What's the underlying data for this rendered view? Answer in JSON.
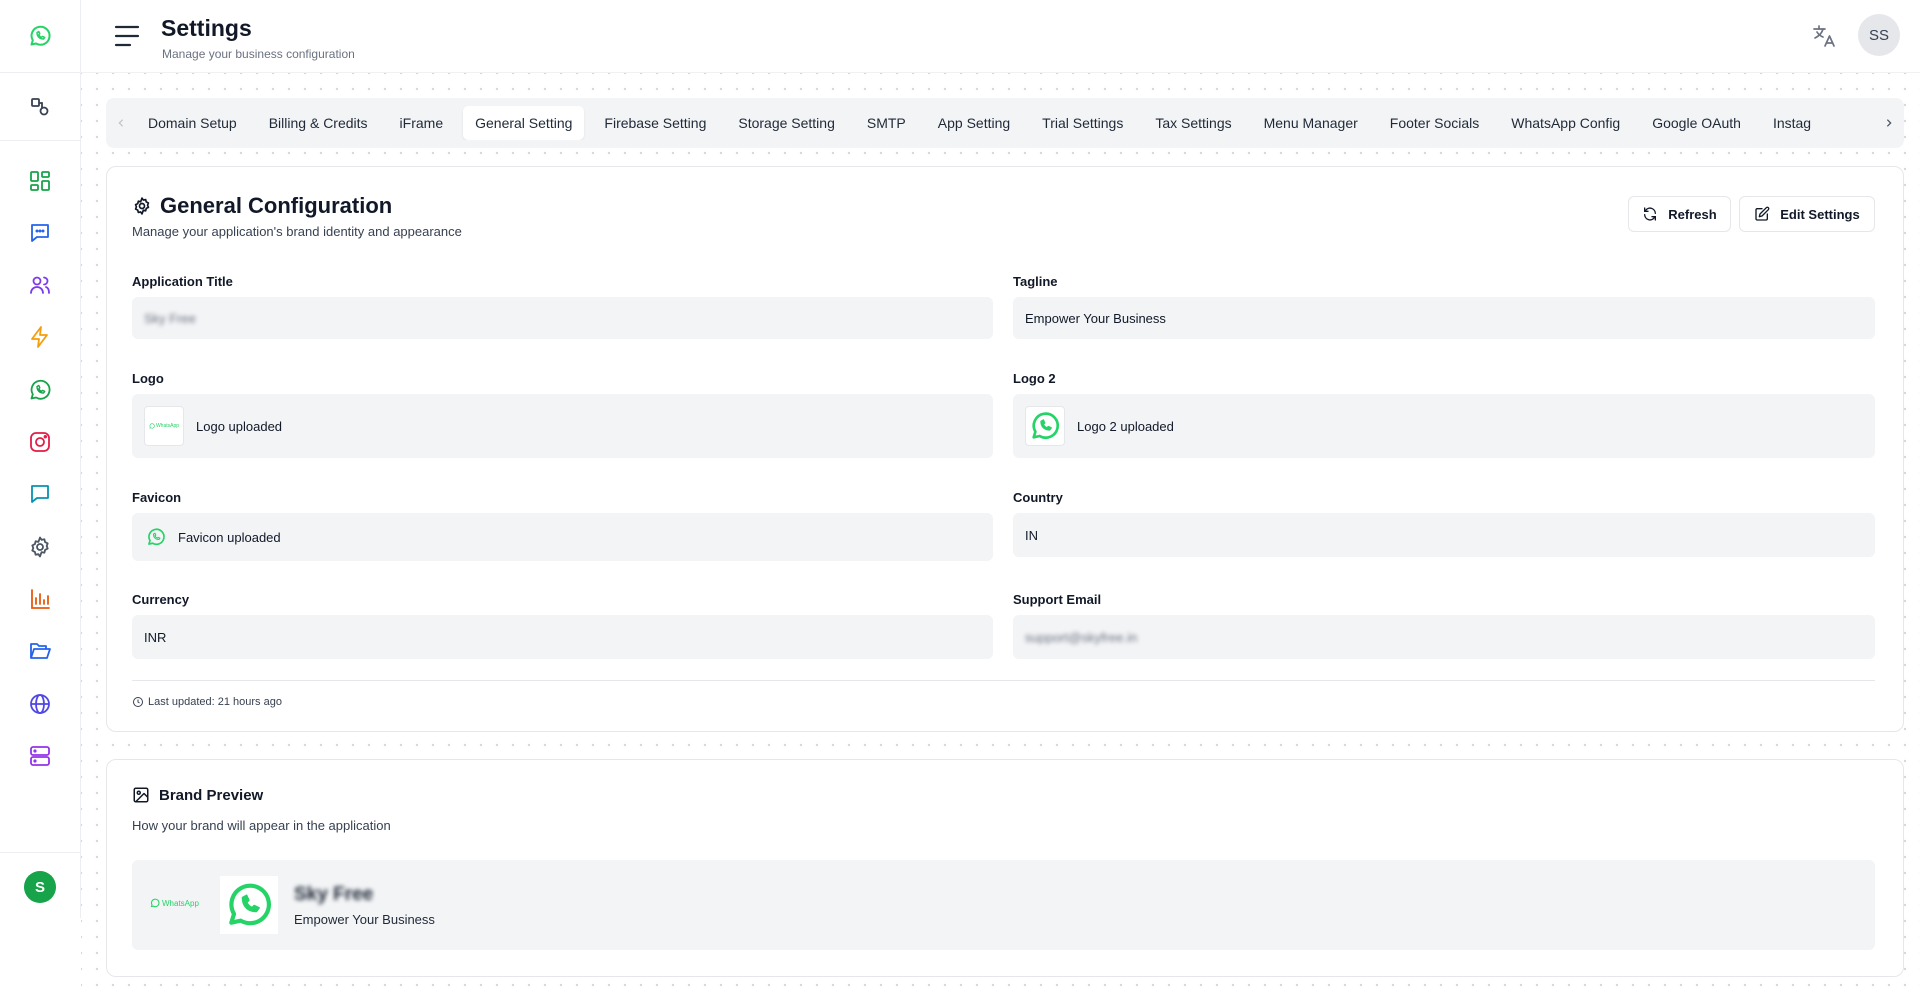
{
  "header": {
    "title": "Settings",
    "subtitle": "Manage your business configuration",
    "avatar_initials": "SS"
  },
  "sidebar": {
    "items": [
      {
        "icon": "whatsapp-logo-icon",
        "color": "#25D366"
      },
      {
        "icon": "shapes-icon",
        "color": "#374151"
      },
      {
        "icon": "dashboard-grid-icon",
        "color": "#16a34a"
      },
      {
        "icon": "chat-bubble-icon",
        "color": "#2563eb"
      },
      {
        "icon": "users-icon",
        "color": "#7c3aed"
      },
      {
        "icon": "lightning-icon",
        "color": "#f59e0b"
      },
      {
        "icon": "whatsapp-icon",
        "color": "#16a34a"
      },
      {
        "icon": "instagram-icon",
        "color": "#e11d48"
      },
      {
        "icon": "message-square-icon",
        "color": "#0891b2"
      },
      {
        "icon": "gear-icon",
        "color": "#4b5563"
      },
      {
        "icon": "bar-chart-icon",
        "color": "#ea580c"
      },
      {
        "icon": "folder-open-icon",
        "color": "#2563eb"
      },
      {
        "icon": "globe-icon",
        "color": "#4f46e5"
      },
      {
        "icon": "server-icon",
        "color": "#9333ea"
      }
    ],
    "user_initial": "S"
  },
  "tabs": [
    {
      "label": "Domain Setup"
    },
    {
      "label": "Billing & Credits"
    },
    {
      "label": "iFrame"
    },
    {
      "label": "General Setting",
      "active": true
    },
    {
      "label": "Firebase Setting"
    },
    {
      "label": "Storage Setting"
    },
    {
      "label": "SMTP"
    },
    {
      "label": "App Setting"
    },
    {
      "label": "Trial Settings"
    },
    {
      "label": "Tax Settings"
    },
    {
      "label": "Menu Manager"
    },
    {
      "label": "Footer Socials"
    },
    {
      "label": "WhatsApp Config"
    },
    {
      "label": "Google OAuth"
    },
    {
      "label": "Instag"
    }
  ],
  "general": {
    "title": "General Configuration",
    "subtitle": "Manage your application's brand identity and appearance",
    "refresh_label": "Refresh",
    "edit_label": "Edit Settings",
    "fields": {
      "app_title": {
        "label": "Application Title",
        "value": "Sky Free"
      },
      "tagline": {
        "label": "Tagline",
        "value": "Empower Your Business"
      },
      "logo": {
        "label": "Logo",
        "value": "Logo uploaded",
        "thumb_text": "WhatsApp"
      },
      "logo2": {
        "label": "Logo 2",
        "value": "Logo 2 uploaded"
      },
      "favicon": {
        "label": "Favicon",
        "value": "Favicon uploaded"
      },
      "country": {
        "label": "Country",
        "value": "IN"
      },
      "currency": {
        "label": "Currency",
        "value": "INR"
      },
      "support_email": {
        "label": "Support Email",
        "value": "support@skyfree.in"
      }
    },
    "last_updated": "Last updated: 21 hours ago"
  },
  "brand": {
    "title": "Brand Preview",
    "subtitle": "How your brand will appear in the application",
    "logo_text": "WhatsApp",
    "name": "Sky Free",
    "tagline": "Empower Your Business"
  },
  "colors": {
    "whatsapp_green": "#25D366",
    "panel_gray": "#f3f4f6"
  }
}
